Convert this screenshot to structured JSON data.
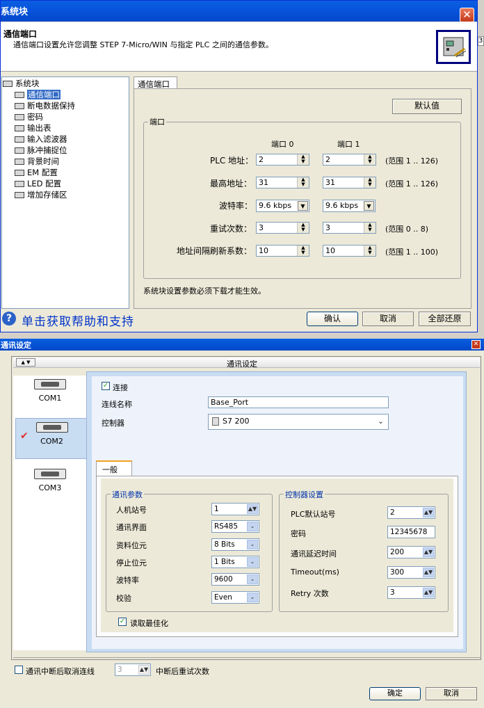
{
  "win1": {
    "title": "系统块",
    "header_title": "通信端口",
    "header_desc": "通信端口设置允许您调整 STEP 7-Micro/WIN 与指定 PLC 之间的通信参数。",
    "tree": [
      "系统块",
      "通信端口",
      "断电数据保持",
      "密码",
      "输出表",
      "输入滤波器",
      "脉冲捕捉位",
      "背景时间",
      "EM 配置",
      "LED 配置",
      "增加存储区"
    ],
    "tab": "通信端口",
    "default_btn": "默认值",
    "group": "端口",
    "col0": "端口 0",
    "col1": "端口 1",
    "rows": [
      {
        "label": "PLC 地址：",
        "v0": "2",
        "v1": "2",
        "range": "(范围 1 .. 126)"
      },
      {
        "label": "最高地址：",
        "v0": "31",
        "v1": "31",
        "range": "(范围 1 .. 126)"
      },
      {
        "label": "波特率：",
        "v0": "9.6 kbps",
        "v1": "9.6 kbps",
        "range": ""
      },
      {
        "label": "重试次数：",
        "v0": "3",
        "v1": "3",
        "range": "(范围 0 .. 8)"
      },
      {
        "label": "地址间隔刷新系数：",
        "v0": "10",
        "v1": "10",
        "range": "(范围 1 .. 100)"
      }
    ],
    "note": "系统块设置参数必须下载才能生效。",
    "help": "单击获取帮助和支持",
    "ok": "确认",
    "cancel": "取消",
    "restore": "全部还原",
    "side_digit": "3"
  },
  "win2": {
    "title": "通讯设定",
    "inner_title": "通讯设定",
    "coms": [
      "COM1",
      "COM2",
      "COM3"
    ],
    "connect_label": "连接",
    "conn_name_label": "连线名称",
    "conn_name": "Base_Port",
    "controller_label": "控制器",
    "controller": "S7 200",
    "tab": "一般",
    "grp1": "通讯参数",
    "grp2": "控制器设置",
    "left_rows": [
      {
        "label": "人机站号",
        "value": "1"
      },
      {
        "label": "通讯界面",
        "value": "RS485"
      },
      {
        "label": "资料位元",
        "value": "8 Bits"
      },
      {
        "label": "停止位元",
        "value": "1 Bits"
      },
      {
        "label": "波特率",
        "value": "9600"
      },
      {
        "label": "校验",
        "value": "Even"
      }
    ],
    "right_rows": [
      {
        "label": "PLC默认站号",
        "value": "2"
      },
      {
        "label": "密码",
        "value": "12345678"
      },
      {
        "label": "通讯延迟时间",
        "value": "200"
      },
      {
        "label": "Timeout(ms)",
        "value": "300"
      },
      {
        "label": "Retry 次数",
        "value": "3"
      }
    ],
    "optimize": "读取最佳化",
    "cancel_conn": "通讯中断后取消连线",
    "retry_count": "3",
    "retry_label": "中断后重试次数",
    "ok": "确定",
    "cancel": "取消"
  }
}
